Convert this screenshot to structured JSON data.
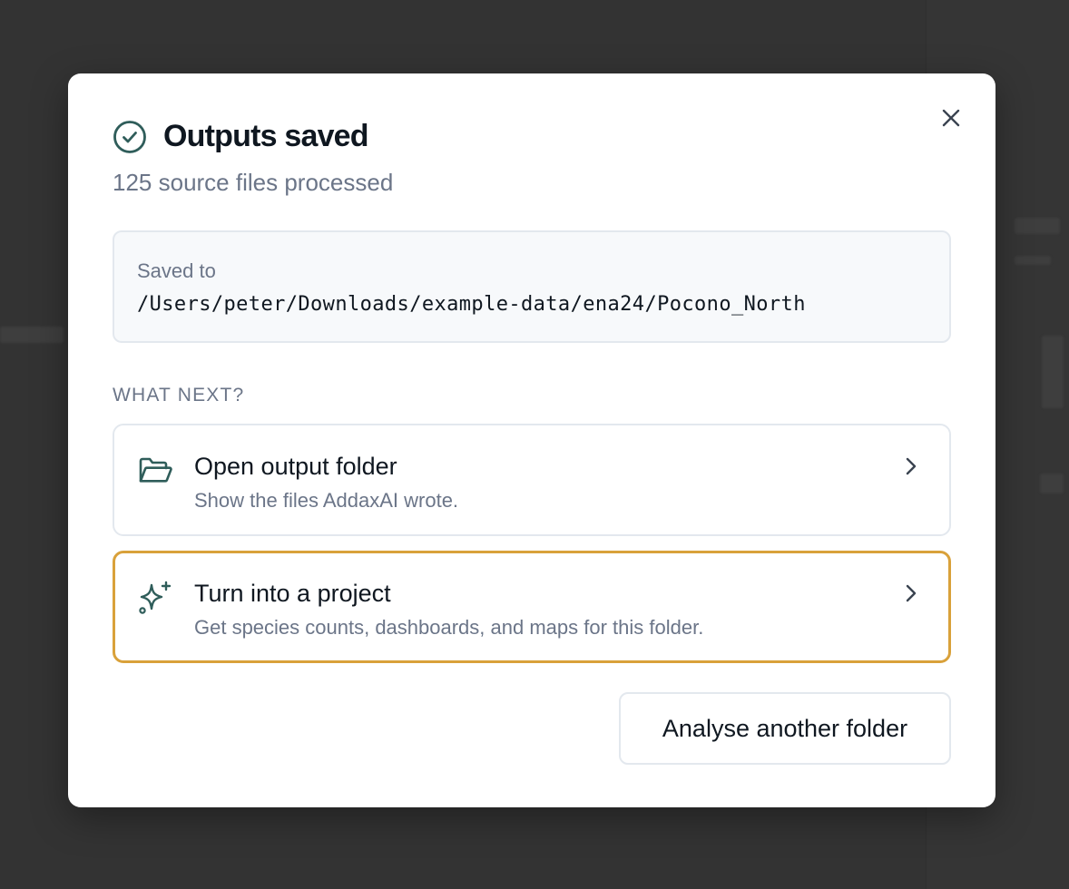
{
  "modal": {
    "title": "Outputs saved",
    "subtitle": "125 source files processed",
    "saved": {
      "label": "Saved to",
      "path": "/Users/peter/Downloads/example-data/ena24/Pocono_North"
    },
    "section_label": "WHAT NEXT?",
    "options": [
      {
        "title": "Open output folder",
        "description": "Show the files AddaxAI wrote.",
        "icon": "folder-open-icon"
      },
      {
        "title": "Turn into a project",
        "description": "Get species counts, dashboards, and maps for this folder.",
        "icon": "sparkles-icon"
      }
    ],
    "secondary_button": "Analyse another folder",
    "colors": {
      "accent_icon": "#2f5d5a",
      "highlight_border": "#d9a13a",
      "muted_text": "#6b7588",
      "text": "#0f1720"
    }
  }
}
